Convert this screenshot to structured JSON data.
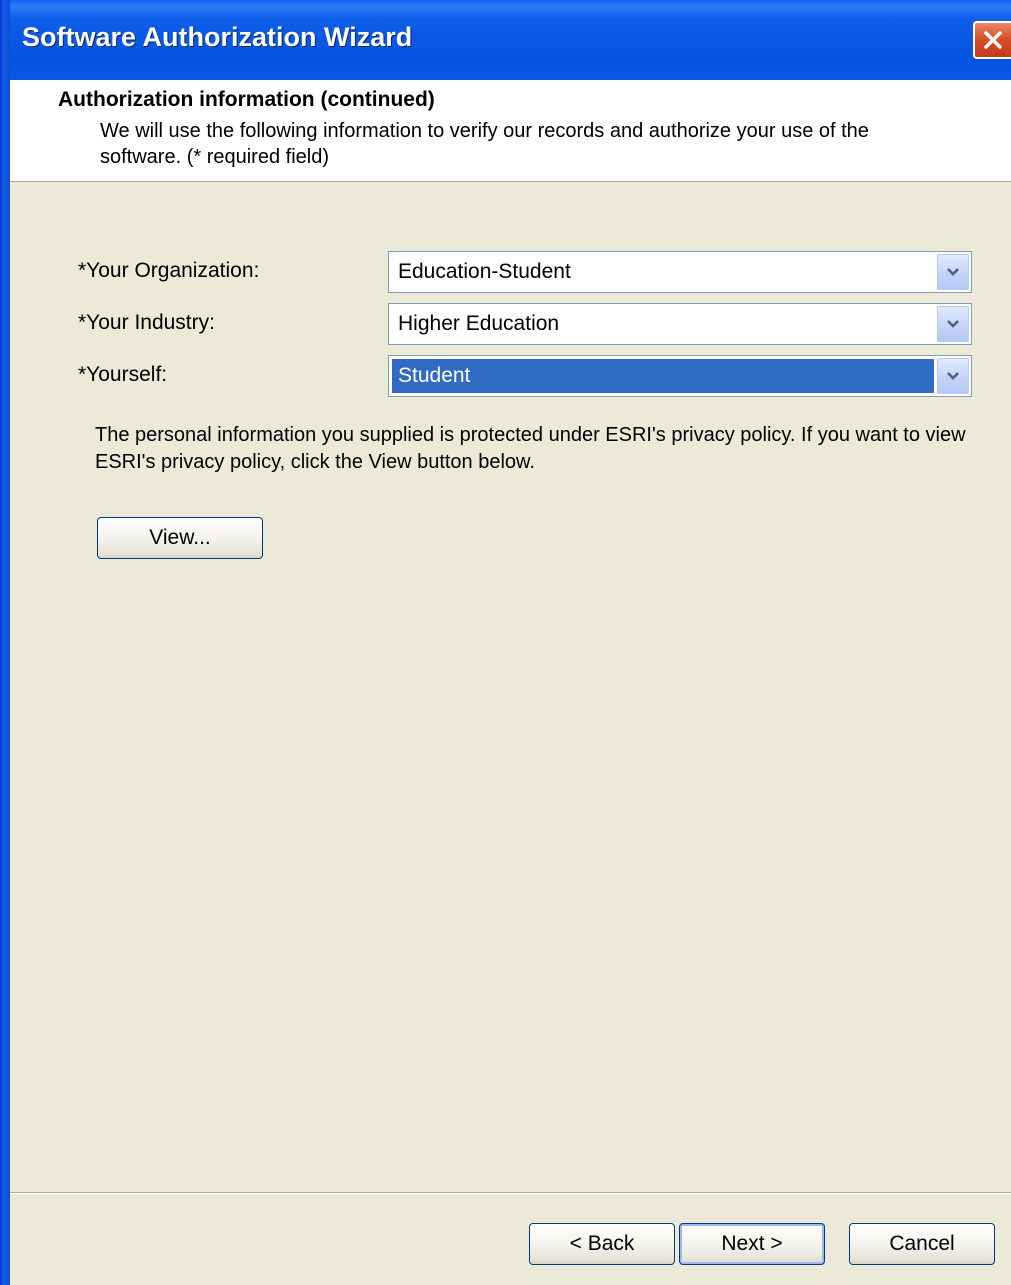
{
  "window": {
    "title": "Software Authorization Wizard"
  },
  "header": {
    "title": "Authorization information (continued)",
    "description": "We will use the following information to verify our records and authorize your use of the software. (* required field)"
  },
  "form": {
    "fields": [
      {
        "label": "*Your Organization:",
        "value": "Education-Student"
      },
      {
        "label": "*Your Industry:",
        "value": "Higher Education"
      },
      {
        "label": "*Yourself:",
        "value": "Student"
      }
    ]
  },
  "privacy": {
    "text": "The personal information you supplied is protected under ESRI's privacy policy. If you want to view ESRI's privacy policy, click the View button below.",
    "view_label": "View..."
  },
  "footer": {
    "back_label": "< Back",
    "next_label": "Next >",
    "cancel_label": "Cancel"
  },
  "colors": {
    "titlebar": "#0754e0",
    "selection": "#316ac5",
    "dialog_bg": "#ece9d8",
    "close_button": "#d8502a"
  },
  "icons": {
    "close": "close-icon",
    "dropdown": "chevron-down-icon"
  }
}
